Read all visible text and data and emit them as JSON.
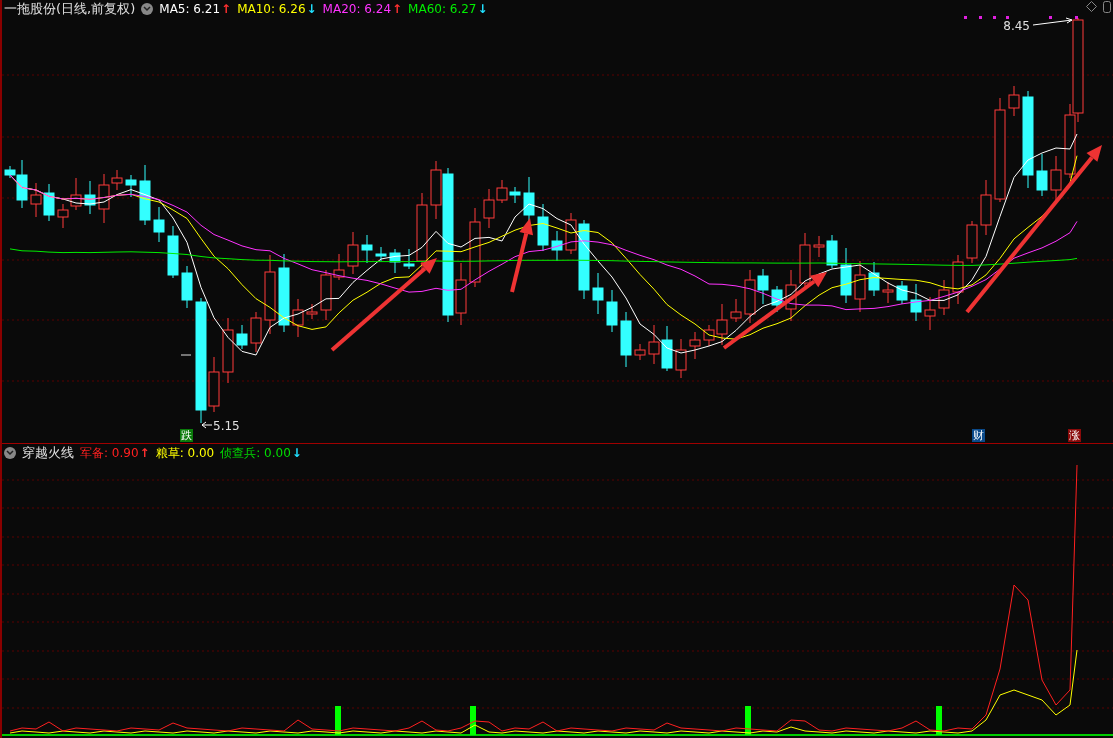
{
  "main_panel": {
    "title": "一拖股份(日线,前复权)",
    "indicators": [
      {
        "name": "MA5:",
        "value": "6.21",
        "arrow": "↑",
        "kind": "up",
        "color": "#ffffff"
      },
      {
        "name": "MA10:",
        "value": "6.26",
        "arrow": "↓",
        "kind": "down",
        "color": "#ffff00"
      },
      {
        "name": "MA20:",
        "value": "6.24",
        "arrow": "↑",
        "kind": "up",
        "color": "#ff33ff"
      },
      {
        "name": "MA60:",
        "value": "6.27",
        "arrow": "↓",
        "kind": "down",
        "color": "#00ee00"
      }
    ],
    "high_label": "8.45",
    "low_label": "5.15",
    "badges": [
      {
        "text": "跌",
        "color": "#0a7a0a"
      },
      {
        "text": "财",
        "color": "#0b4a8a"
      },
      {
        "text": "涨",
        "color": "#8a0a0a"
      }
    ]
  },
  "sub_panel": {
    "title": "穿越火线",
    "indicators": [
      {
        "name": "军备:",
        "value": "0.90",
        "arrow": "↑",
        "kind": "up",
        "color": "#ff2020"
      },
      {
        "name": "粮草:",
        "value": "0.00",
        "color": "#ffff00"
      },
      {
        "name": "侦查兵:",
        "value": "0.00",
        "arrow": "↓",
        "kind": "down",
        "color": "#00dd00"
      }
    ]
  }
}
